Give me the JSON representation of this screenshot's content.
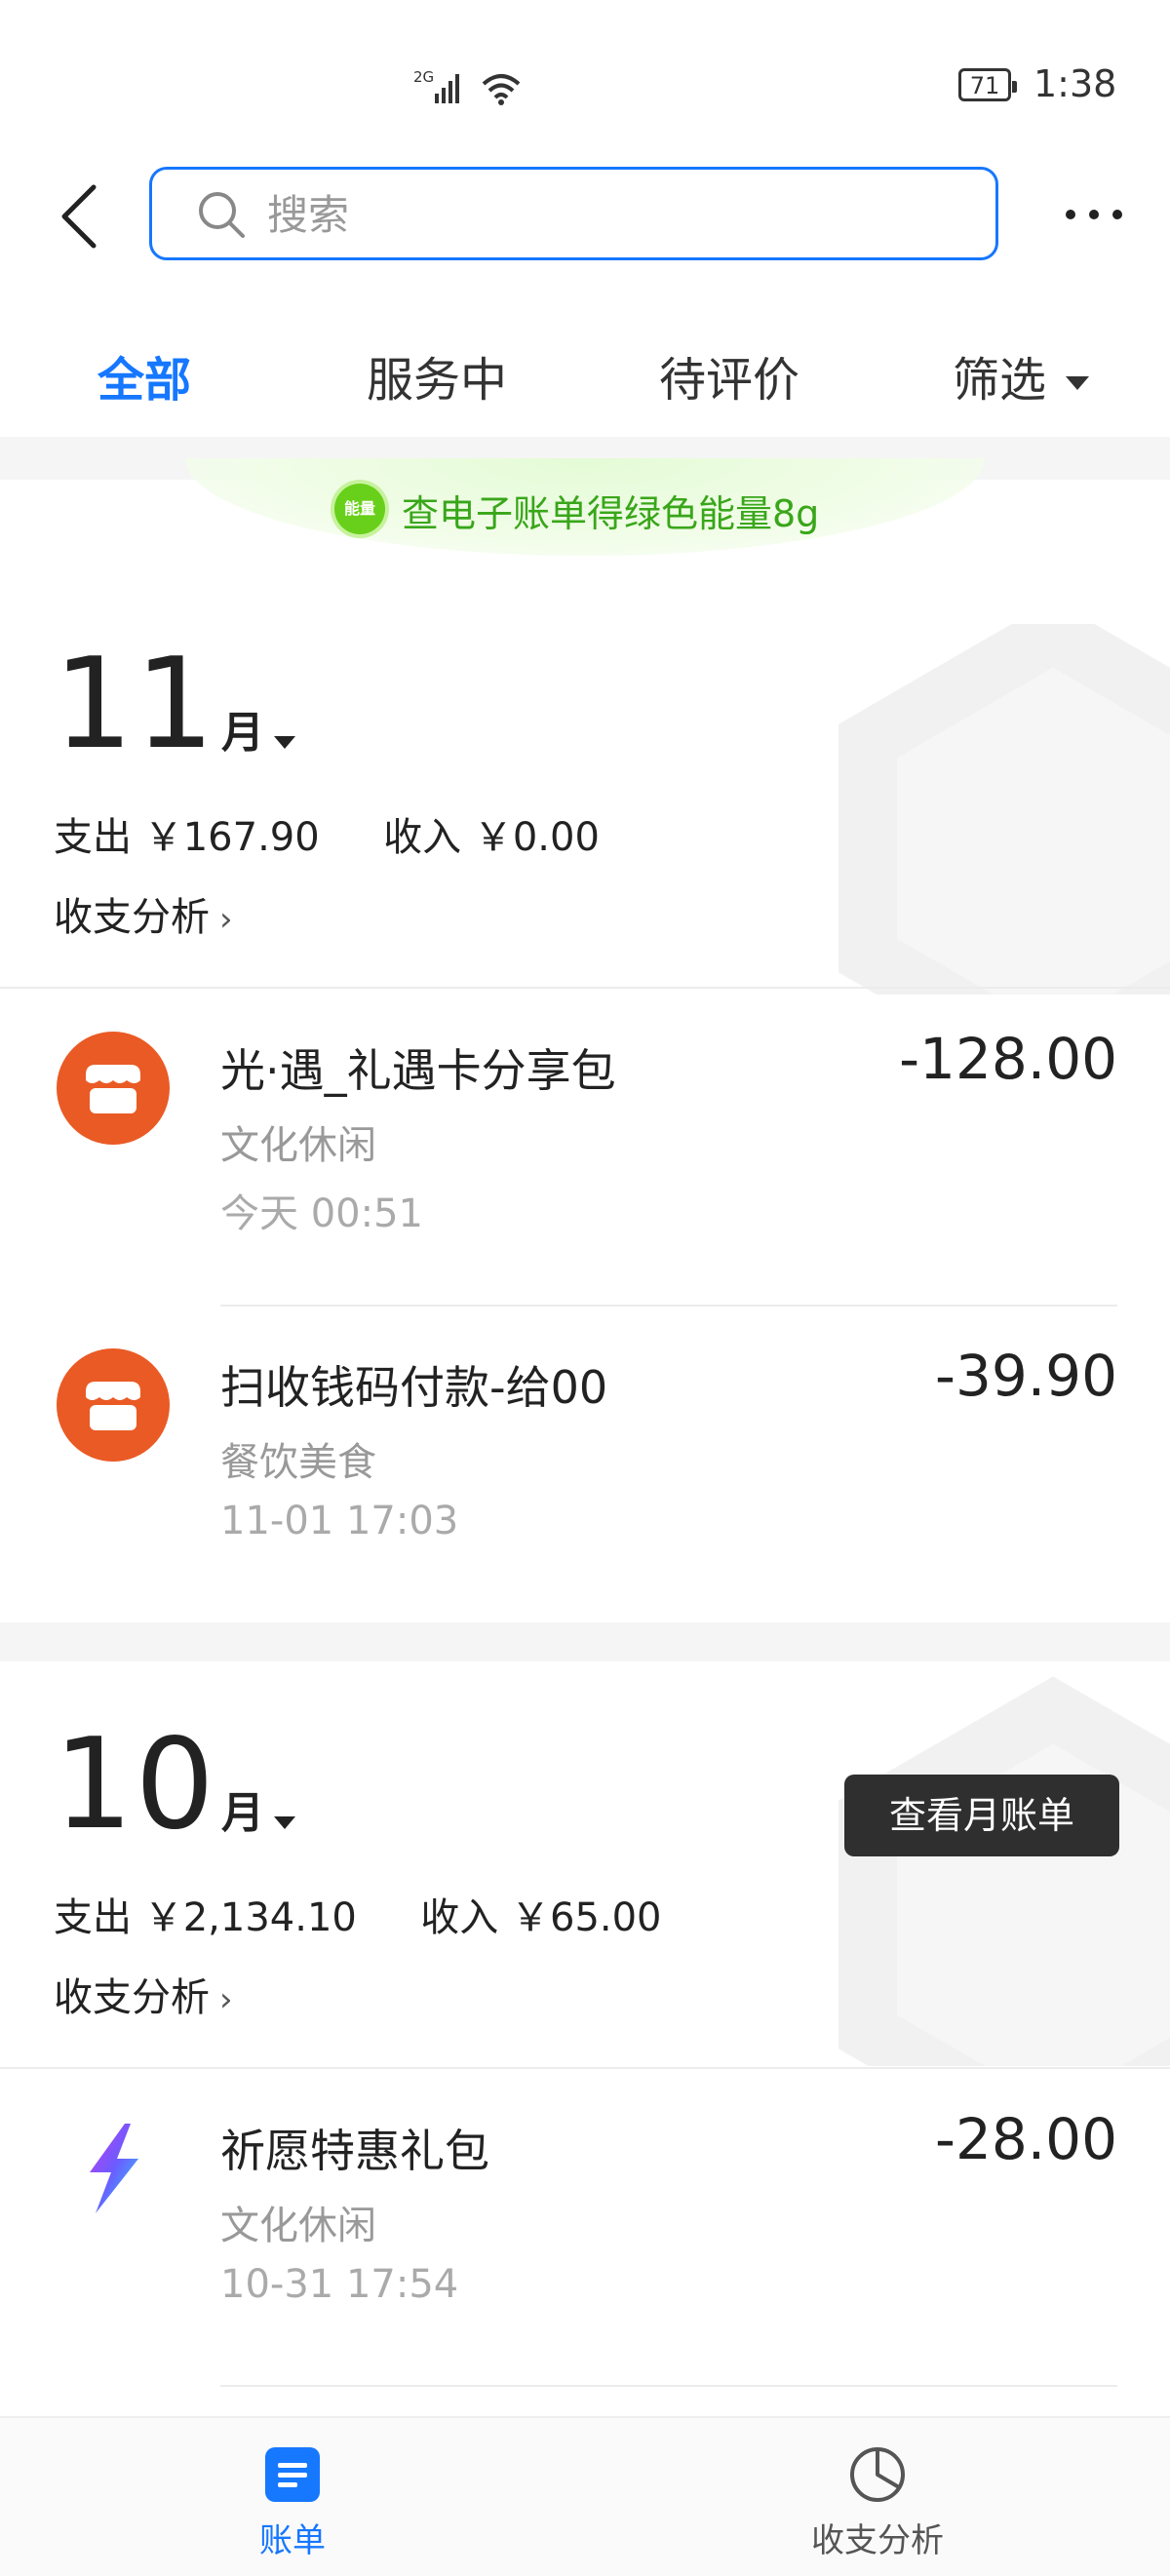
{
  "status_bar": {
    "network": "2G",
    "battery": "71",
    "time": "1:38"
  },
  "search": {
    "placeholder": "搜索"
  },
  "tabs": [
    {
      "label": "全部",
      "active": true
    },
    {
      "label": "服务中",
      "active": false
    },
    {
      "label": "待评价",
      "active": false
    },
    {
      "label": "筛选",
      "active": false
    }
  ],
  "banner": {
    "badge": "能量",
    "text": "查电子账单得绿色能量8g"
  },
  "months": [
    {
      "month": "11",
      "unit": "月",
      "expense_label": "支出",
      "expense": "￥167.90",
      "income_label": "收入",
      "income": "￥0.00",
      "analysis_label": "收支分析",
      "transactions": [
        {
          "title": "光·遇_礼遇卡分享包",
          "amount": "-128.00",
          "category": "文化休闲",
          "time": "今天  00:51",
          "icon": "store-icon"
        },
        {
          "title": "扫收钱码付款-给00",
          "amount": "-39.90",
          "category": "餐饮美食",
          "time": "11-01  17:03",
          "icon": "store-icon"
        }
      ]
    },
    {
      "month": "10",
      "unit": "月",
      "expense_label": "支出",
      "expense": "￥2,134.10",
      "income_label": "收入",
      "income": "￥65.00",
      "analysis_label": "收支分析",
      "view_bill_label": "查看月账单",
      "transactions": [
        {
          "title": "祈愿特惠礼包",
          "amount": "-28.00",
          "category": "文化休闲",
          "time": "10-31  17:54",
          "icon": "lightning-app-icon"
        }
      ]
    }
  ],
  "bottom_nav": [
    {
      "label": "账单",
      "icon": "bill-icon",
      "active": true
    },
    {
      "label": "收支分析",
      "icon": "pie-chart-icon",
      "active": false
    }
  ],
  "colors": {
    "accent": "#1677ff",
    "store_orange": "#ea5a25",
    "energy_green": "#39a61a"
  }
}
